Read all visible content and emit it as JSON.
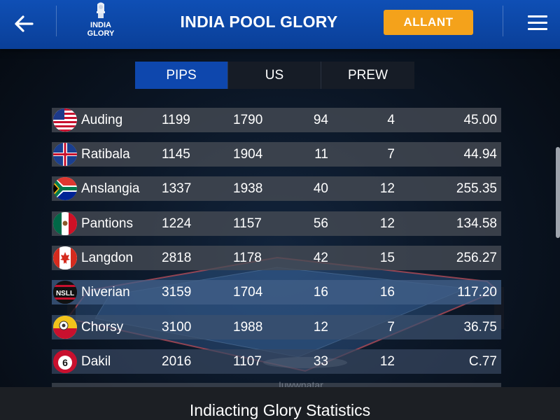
{
  "header": {
    "logo_text": "INDIA\nGLORY",
    "title": "INDIA POOL GLORY",
    "alert_button": "ALLANT",
    "brand_color": "#0d4bb0",
    "alert_color": "#f4a21b"
  },
  "tabs": [
    {
      "label": "PIPS",
      "active": true
    },
    {
      "label": "US",
      "active": false
    },
    {
      "label": "PREW",
      "active": false
    }
  ],
  "rows": [
    {
      "flag": "usa-flag",
      "name": "Auding",
      "a": "1199",
      "b": "1790",
      "c": "94",
      "d": "4",
      "e": "45.00"
    },
    {
      "flag": "blue-cross-flag",
      "name": "Ratibala",
      "a": "1145",
      "b": "1904",
      "c": "11",
      "d": "7",
      "e": "44.94"
    },
    {
      "flag": "south-africa-flag",
      "name": "Anslangia",
      "a": "1337",
      "b": "1938",
      "c": "40",
      "d": "12",
      "e": "255.35"
    },
    {
      "flag": "mexico-flag",
      "name": "Pantions",
      "a": "1224",
      "b": "1157",
      "c": "56",
      "d": "12",
      "e": "134.58"
    },
    {
      "flag": "canada-flag",
      "name": "Langdon",
      "a": "2818",
      "b": "1178",
      "c": "42",
      "d": "15",
      "e": "256.27"
    },
    {
      "flag": "nsll-badge",
      "name": "Niverian",
      "a": "3159",
      "b": "1704",
      "c": "16",
      "d": "16",
      "e": "117.20"
    },
    {
      "flag": "yellow-red-flag",
      "name": "Chorsy",
      "a": "3100",
      "b": "1988",
      "c": "12",
      "d": "7",
      "e": "36.75"
    },
    {
      "flag": "ball-6-icon",
      "name": "Dakil",
      "a": "2016",
      "b": "1107",
      "c": "33",
      "d": "12",
      "e": "C.77"
    }
  ],
  "ball_number": "6",
  "nsll_text": "NSLL",
  "partial_row_text": "Iuwwnatar",
  "bottom": {
    "title": "Indiacting Glory Statistics"
  }
}
